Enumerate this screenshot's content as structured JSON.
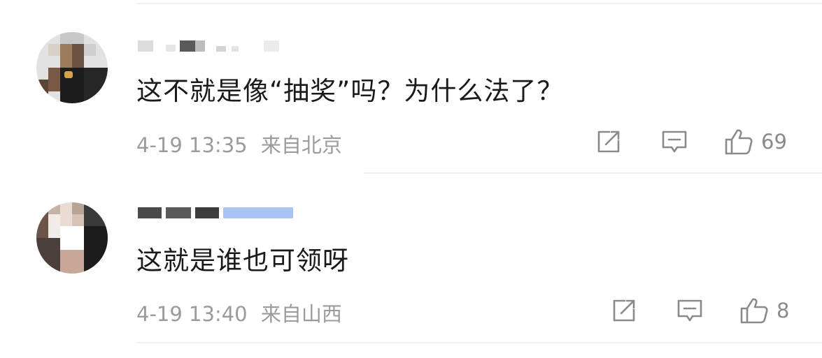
{
  "comments": [
    {
      "text": "这不就是像“抽奖”吗？为什么法了？",
      "time": "4-19 13:35",
      "location": "来自北京",
      "likes": "69",
      "actions": {
        "share_icon": "share-icon",
        "reply_icon": "reply-icon",
        "like_icon": "thumbs-up-icon"
      }
    },
    {
      "text": "这就是谁也可领呀",
      "time": "4-19 13:40",
      "location": "来自山西",
      "likes": "8",
      "actions": {
        "share_icon": "share-icon",
        "reply_icon": "reply-icon",
        "like_icon": "thumbs-up-icon"
      }
    }
  ],
  "colors": {
    "text": "#1a1a1a",
    "meta": "#9b9b9b",
    "icon": "#8a8a8a",
    "divider": "#f1f1f1",
    "badge": "#a9c4f2"
  }
}
